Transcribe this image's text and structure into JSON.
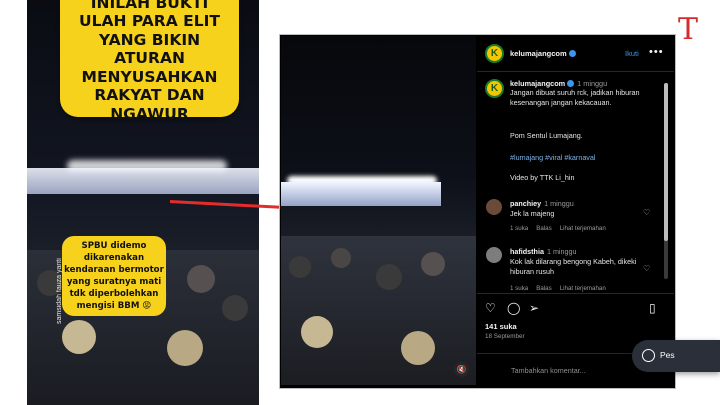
{
  "left_video": {
    "headline": "INILAH BUKTI ULAH PARA ELIT YANG BIKIN ATURAN MENYUSAHKAN RAKYAT DAN NGAWUR",
    "callout": "SPBU didemo dikarenakan kendaraan bermotor yang suratnya mati tdk diperbolehkan mengisi BBM 😡",
    "watermark": "samsidah fauza yanti"
  },
  "instagram": {
    "header": {
      "username": "kelumajangcom",
      "follow": "Ikuti",
      "more": "•••"
    },
    "caption": {
      "username": "kelumajangcom",
      "time": "1 minggu",
      "text": "Jangan dibuat suruh rck, jadikan hiburan kesenangan jangan kekacauan.",
      "location": "Pom Sentul Lumajang.",
      "hashtags": "#lumajang #viral #karnaval",
      "credit": "Video by TTK Li_hin"
    },
    "comments": [
      {
        "username": "panchiey",
        "time": "1 minggu",
        "text": "Jek la majeng",
        "likes": "1 suka",
        "reply": "Balas",
        "translate": "Lihat terjemahan"
      },
      {
        "username": "hafidsthia",
        "time": "1 minggu",
        "text": "Kok lak dilarang bengong Kabeh, dikeki hiburan rusuh",
        "likes": "1 suka",
        "reply": "Balas",
        "translate": "Lihat terjemahan"
      }
    ],
    "likes": "141 suka",
    "date": "18 September",
    "add_comment_placeholder": "Tambahkan komentar..."
  },
  "messages_pill": {
    "label": "Pes"
  },
  "brand_letter": "T",
  "colors": {
    "arrow": "#e52c2c",
    "highlight_yellow": "#f7d21c",
    "ig_link": "#3897f0"
  }
}
